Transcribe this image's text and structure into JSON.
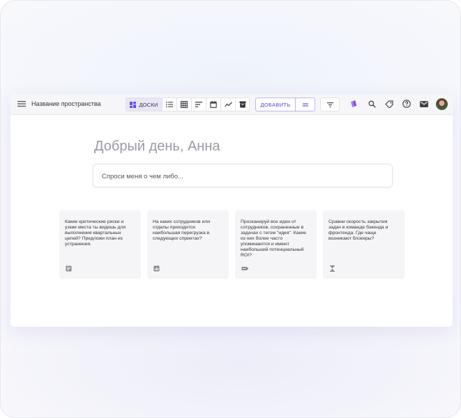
{
  "header": {
    "space_name": "Название пространства",
    "view_active_label": "ДОСКИ",
    "add_label": "ДОБАВИТЬ"
  },
  "main": {
    "greeting": "Добрый день, Анна",
    "ask_placeholder": "Спроси меня о чем либо..."
  },
  "cards": [
    {
      "text": "Какие критические риски и узкие места ты видишь для выполнения квартальных целей? Предложи план их устранения.",
      "icon": "document-icon"
    },
    {
      "text": "На каких сотрудников или отделы приходится наибольшая перегрузка в следующих спринтах?",
      "icon": "chart-icon"
    },
    {
      "text": "Просканируй все идеи от сотрудников, сохраненные в задачах с тегом \"идея\". Какие из них более часто упоминаются и имеют наибольший потенциальный ROI?",
      "icon": "tag-icon"
    },
    {
      "text": "Сравни скорость закрытия задач в команде бэкенда и фронтенда. Где чаще возникают блокеры?",
      "icon": "hourglass-icon"
    }
  ],
  "colors": {
    "accent": "#5a3fd6",
    "active_view_bg": "#e9e6f7",
    "brand_tile": "#7b4de8"
  }
}
